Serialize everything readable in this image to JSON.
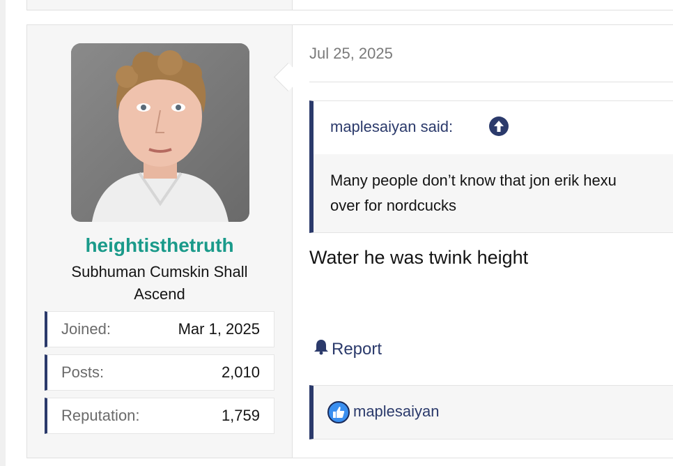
{
  "post": {
    "user": {
      "username": "heightisthetruth",
      "title": "Subhuman Cumskin Shall Ascend",
      "stats": [
        {
          "label": "Joined:",
          "value": "Mar 1, 2025"
        },
        {
          "label": "Posts:",
          "value": "2,010"
        },
        {
          "label": "Reputation:",
          "value": "1,759"
        }
      ]
    },
    "date": "Jul 25, 2025",
    "quote": {
      "author": "maplesaiyan said:",
      "text_line1": "Many people don’t know that jon erik hexu",
      "text_line2": "over for nordcucks"
    },
    "message": "Water he was twink height",
    "actions": {
      "report_label": "Report"
    },
    "reactions": {
      "user": "maplesaiyan"
    }
  },
  "colors": {
    "accent": "#2b3a6b",
    "username": "#1a9a8a",
    "userblock_bg": "#f6f6f6"
  },
  "icons": [
    "arrow-up-circle-icon",
    "bell-icon",
    "thumbs-up-icon"
  ]
}
